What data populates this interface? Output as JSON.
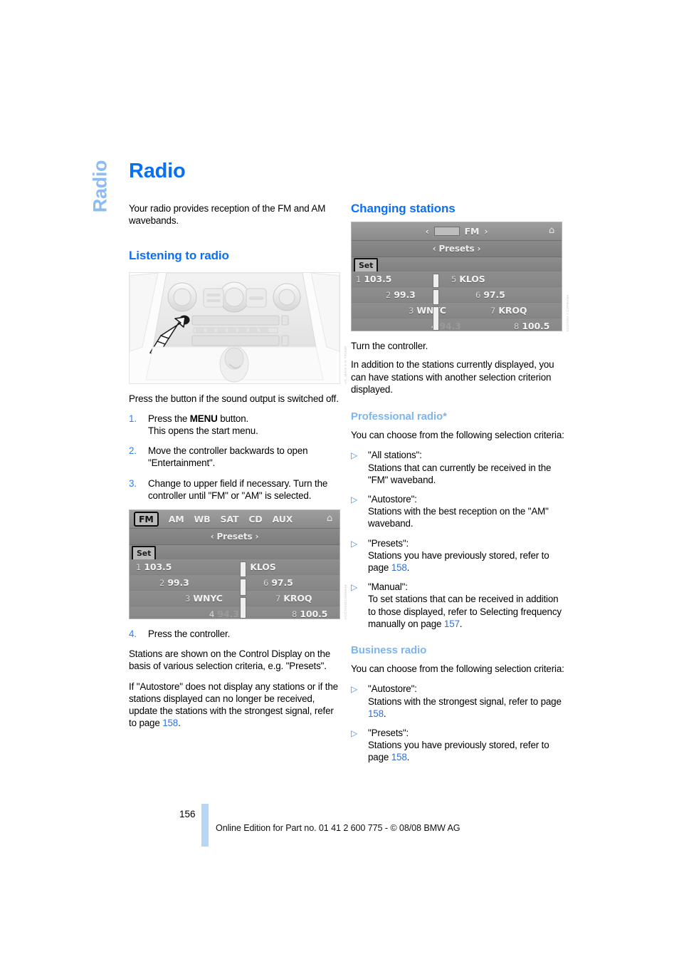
{
  "chapter_tab": {
    "label": "Radio"
  },
  "page_title": "Radio",
  "left": {
    "intro": "Your radio provides reception of the FM and AM wavebands.",
    "section_heading": "Listening to radio",
    "dashboard_figure": {
      "alt": "Center console with radio on/off button",
      "credit": "US_MAIN  E.R.TRUMP"
    },
    "press_button_text": "Press the button if the sound output is switched off.",
    "steps": [
      {
        "num": "1.",
        "text_before": "Press the ",
        "bold": "MENU",
        "text_after": " button.",
        "line2": "This opens the start menu."
      },
      {
        "num": "2.",
        "text": "Move the controller backwards to open \"Entertainment\"."
      },
      {
        "num": "3.",
        "text": "Change to upper field if necessary. Turn the controller until \"FM\" or \"AM\" is selected."
      }
    ],
    "display": {
      "credit": "VCD7050512655646",
      "tabs": [
        "FM",
        "AM",
        "WB",
        "SAT",
        "CD",
        "AUX"
      ],
      "selected_tab": "FM",
      "home_icon": "home-icon",
      "subbar": "Presets",
      "set_label": "Set",
      "presets": [
        {
          "left_idx": "1",
          "left_name": "103.5",
          "right_idx": "5",
          "right_name": "KLOS"
        },
        {
          "left_idx": "2",
          "left_name": "99.3",
          "right_idx": "6",
          "right_name": "97.5"
        },
        {
          "left_idx": "3",
          "left_name": "WNYC",
          "right_idx": "7",
          "right_name": "KROQ"
        },
        {
          "left_idx": "4",
          "left_name": "94.3",
          "right_idx": "8",
          "right_name": "100.5"
        }
      ]
    },
    "step4": {
      "num": "4.",
      "text": "Press the controller."
    },
    "para_stations": "Stations are shown on the Control Display on the basis of various selection criteria, e.g. \"Presets\".",
    "para_autostore_before": "If \"Autostore\" does not display any stations or if the stations displayed can no longer be received, update the stations with the strongest signal, refer to page ",
    "para_autostore_page": "158",
    "para_autostore_after": "."
  },
  "right": {
    "heading_changing": "Changing stations",
    "display": {
      "credit": "VCD7051 / CVPBANK",
      "header_band": "FM",
      "home_icon": "home-icon",
      "subbar": "Presets",
      "set_label": "Set",
      "presets": [
        {
          "left_idx": "1",
          "left_name": "103.5",
          "right_idx": "5",
          "right_name": "KLOS"
        },
        {
          "left_idx": "2",
          "left_name": "99.3",
          "right_idx": "6",
          "right_name": "97.5"
        },
        {
          "left_idx": "3",
          "left_name": "WNYC",
          "right_idx": "7",
          "right_name": "KROQ"
        },
        {
          "left_idx": "4",
          "left_name": "94.3",
          "right_idx": "8",
          "right_name": "100.5"
        }
      ]
    },
    "turn_controller": "Turn the controller.",
    "para_addition": "In addition to the stations currently displayed, you can have stations with another selection criterion displayed.",
    "professional": {
      "heading": "Professional radio*",
      "intro": "You can choose from the following selection criteria:",
      "items": [
        {
          "title": "\"All stations\":",
          "body": "Stations that can currently be received in the \"FM\" waveband."
        },
        {
          "title": "\"Autostore\":",
          "body": "Stations with the best reception on the \"AM\" waveband."
        },
        {
          "title": "\"Presets\":",
          "body_before": "Stations you have previously stored, refer to page ",
          "page": "158",
          "body_after": "."
        },
        {
          "title": "\"Manual\":",
          "body_before": "To set stations that can be received in addition to those displayed, refer to Selecting frequency manually on page ",
          "page": "157",
          "body_after": "."
        }
      ]
    },
    "business": {
      "heading": "Business radio",
      "intro": "You can choose from the following selection criteria:",
      "items": [
        {
          "title": "\"Autostore\":",
          "body_before": "Stations with the strongest signal, refer to page ",
          "page": "158",
          "body_after": "."
        },
        {
          "title": "\"Presets\":",
          "body_before": "Stations you have previously stored, refer to page ",
          "page": "158",
          "body_after": "."
        }
      ]
    }
  },
  "footer": {
    "page_number": "156",
    "text": "Online Edition for Part no. 01 41 2 600 775 - © 08/08 BMW AG"
  },
  "colors": {
    "heading_blue": "#0b6ff5",
    "subheading_blue": "#7fb4ee",
    "tab_blue": "#8cbcf0",
    "link_blue": "#2f6fe0",
    "footer_bar": "#b9d5f4"
  }
}
